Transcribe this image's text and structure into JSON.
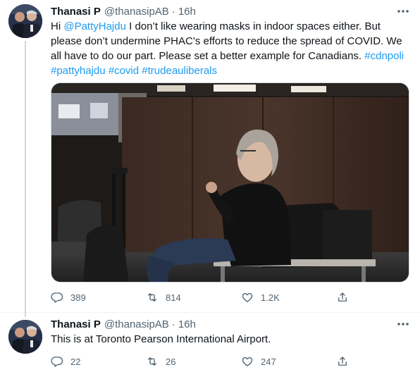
{
  "tweets": [
    {
      "display_name": "Thanasi P",
      "handle": "@thanasipAB",
      "separator": "·",
      "time": "16h",
      "text_parts": [
        {
          "t": "Hi ",
          "k": "plain"
        },
        {
          "t": "@PattyHajdu",
          "k": "mention"
        },
        {
          "t": " I don’t like wearing masks in indoor spaces either. But please don’t undermine PHAC’s efforts to reduce the spread of COVID. We all have to do our part.  Please set a better example for Canadians. ",
          "k": "plain"
        },
        {
          "t": "#cdnpoli",
          "k": "hashtag"
        },
        {
          "t": " ",
          "k": "plain"
        },
        {
          "t": "#pattyhajdu",
          "k": "hashtag"
        },
        {
          "t": " ",
          "k": "plain"
        },
        {
          "t": "#covid",
          "k": "hashtag"
        },
        {
          "t": " ",
          "k": "plain"
        },
        {
          "t": "#trudeauliberals",
          "k": "hashtag"
        }
      ],
      "replies": "389",
      "retweets": "814",
      "likes": "1.2K"
    },
    {
      "display_name": "Thanasi P",
      "handle": "@thanasipAB",
      "separator": "·",
      "time": "16h",
      "text": "This is at Toronto Pearson International Airport.",
      "replies": "22",
      "retweets": "26",
      "likes": "247"
    }
  ],
  "icons": {
    "reply": "reply-icon",
    "retweet": "retweet-icon",
    "like": "heart-icon",
    "share": "share-icon",
    "more": "more-icon"
  },
  "colors": {
    "link": "#1d9bf0",
    "secondary_text": "#536471",
    "primary_text": "#0f1419"
  }
}
